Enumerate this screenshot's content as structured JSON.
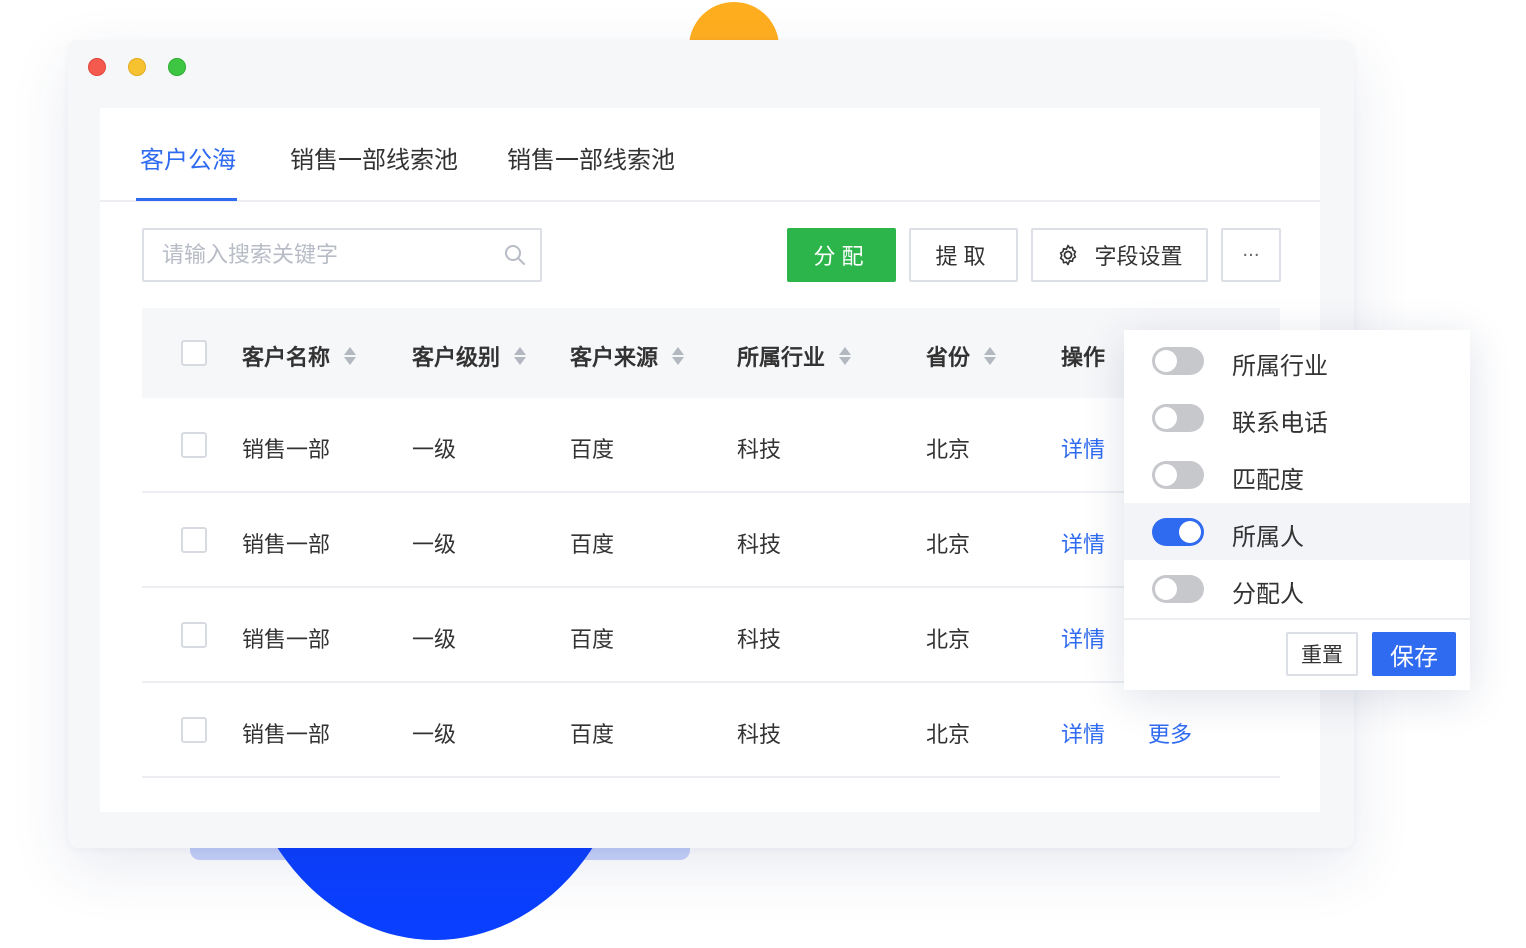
{
  "tabs": [
    {
      "label": "客户公海",
      "active": true
    },
    {
      "label": "销售一部线索池",
      "active": false
    },
    {
      "label": "销售一部线索池",
      "active": false
    }
  ],
  "search": {
    "placeholder": "请输入搜索关键字",
    "value": ""
  },
  "toolbar": {
    "assign_label": "分配",
    "extract_label": "提取",
    "field_settings_label": "字段设置",
    "more_label": "···"
  },
  "table": {
    "headers": [
      "客户名称",
      "客户级别",
      "客户来源",
      "所属行业",
      "省份",
      "操作"
    ],
    "rows": [
      {
        "name": "销售一部",
        "level": "一级",
        "source": "百度",
        "industry": "科技",
        "province": "北京",
        "detail": "详情",
        "more": ""
      },
      {
        "name": "销售一部",
        "level": "一级",
        "source": "百度",
        "industry": "科技",
        "province": "北京",
        "detail": "详情",
        "more": ""
      },
      {
        "name": "销售一部",
        "level": "一级",
        "source": "百度",
        "industry": "科技",
        "province": "北京",
        "detail": "详情",
        "more": ""
      },
      {
        "name": "销售一部",
        "level": "一级",
        "source": "百度",
        "industry": "科技",
        "province": "北京",
        "detail": "详情",
        "more": "更多"
      }
    ]
  },
  "field_popover": {
    "options": [
      {
        "label": "所属行业",
        "enabled": false
      },
      {
        "label": "联系电话",
        "enabled": false
      },
      {
        "label": "匹配度",
        "enabled": false
      },
      {
        "label": "所属人",
        "enabled": true
      },
      {
        "label": "分配人",
        "enabled": false
      }
    ],
    "reset_label": "重置",
    "save_label": "保存"
  },
  "colors": {
    "accent": "#2f6bf0",
    "assign_green": "#2bb54a",
    "blob_orange": "#ffae1f",
    "blob_blue": "#0b3fff"
  }
}
